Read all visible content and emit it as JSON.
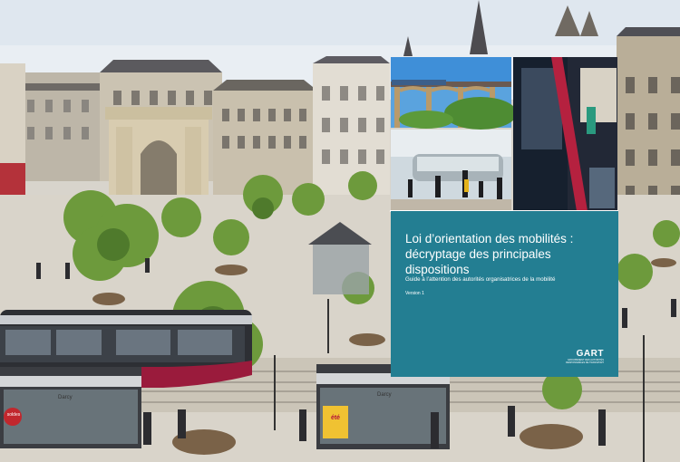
{
  "cover": {
    "title_line1": "Loi d’orientation des mobilités :",
    "title_line2": "décryptage des principales dispositions",
    "subtitle": "Guide à l’attention des autorités organisatrices de la mobilité",
    "version": "Version 1",
    "logo_word": "GART",
    "logo_tagline": "GROUPEMENT DES AUTORITÉS RESPONSABLES DE TRANSPORT"
  },
  "shelters": {
    "left_sign": "Darcy",
    "right_sign": "Darcy",
    "poster_left": "soldes",
    "poster_right": "été"
  },
  "colors": {
    "cover_bg": "#237e92",
    "tram_accent": "#9a1b3c",
    "sky": "#e8eef4"
  }
}
